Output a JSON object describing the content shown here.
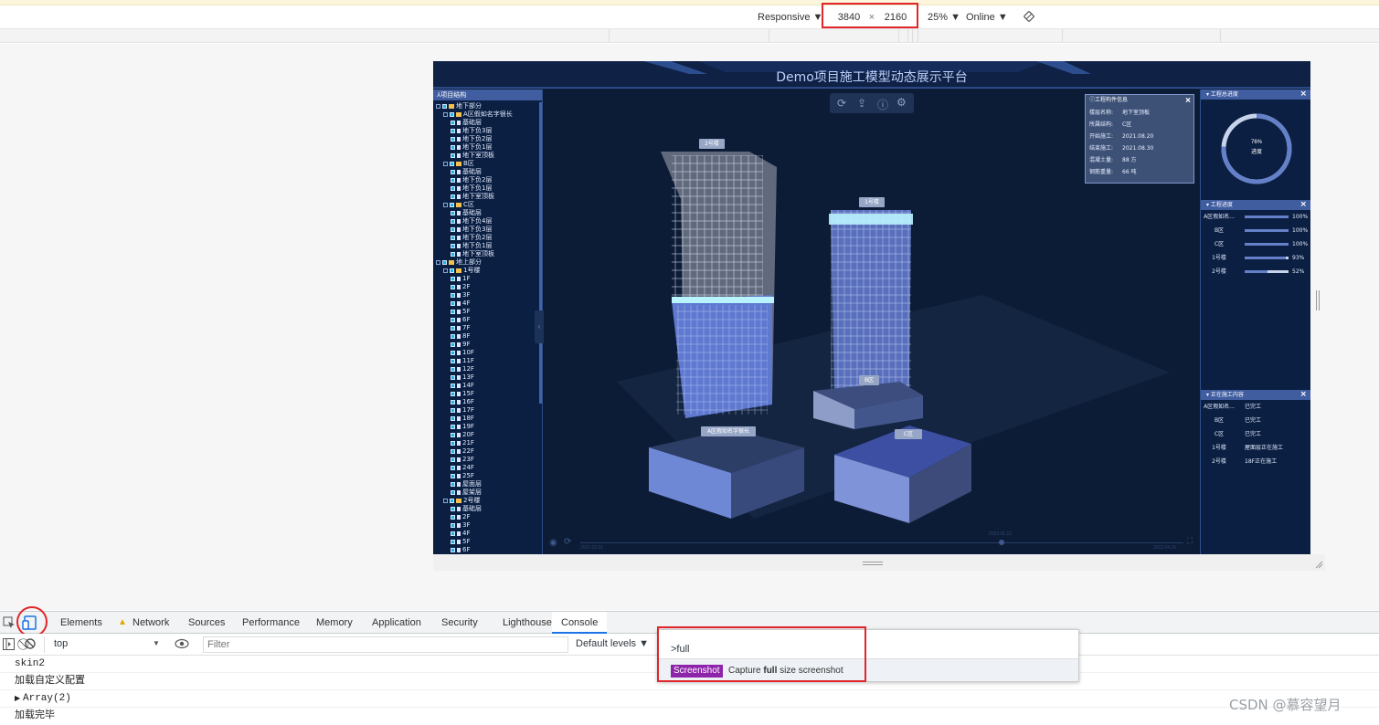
{
  "device_toolbar": {
    "device": "Responsive",
    "width": "3840",
    "times": "×",
    "height": "2160",
    "zoom": "25%",
    "network": "Online"
  },
  "app": {
    "title": "Demo项目施工模型动态展示平台",
    "tree_title": "项目结构",
    "tree": [
      {
        "depth": 0,
        "label": "地下部分",
        "type": "folder",
        "exp": true
      },
      {
        "depth": 1,
        "label": "A区假如名字很长",
        "type": "folder",
        "exp": true
      },
      {
        "depth": 2,
        "label": "基础层",
        "type": "file"
      },
      {
        "depth": 2,
        "label": "地下负3层",
        "type": "file"
      },
      {
        "depth": 2,
        "label": "地下负2层",
        "type": "file"
      },
      {
        "depth": 2,
        "label": "地下负1层",
        "type": "file"
      },
      {
        "depth": 2,
        "label": "地下室顶板",
        "type": "file"
      },
      {
        "depth": 1,
        "label": "B区",
        "type": "folder",
        "exp": true
      },
      {
        "depth": 2,
        "label": "基础层",
        "type": "file"
      },
      {
        "depth": 2,
        "label": "地下负2层",
        "type": "file"
      },
      {
        "depth": 2,
        "label": "地下负1层",
        "type": "file"
      },
      {
        "depth": 2,
        "label": "地下室顶板",
        "type": "file"
      },
      {
        "depth": 1,
        "label": "C区",
        "type": "folder",
        "exp": true
      },
      {
        "depth": 2,
        "label": "基础层",
        "type": "file"
      },
      {
        "depth": 2,
        "label": "地下负4层",
        "type": "file"
      },
      {
        "depth": 2,
        "label": "地下负3层",
        "type": "file"
      },
      {
        "depth": 2,
        "label": "地下负2层",
        "type": "file"
      },
      {
        "depth": 2,
        "label": "地下负1层",
        "type": "file"
      },
      {
        "depth": 2,
        "label": "地下室顶板",
        "type": "file"
      },
      {
        "depth": 0,
        "label": "地上部分",
        "type": "folder",
        "exp": true
      },
      {
        "depth": 1,
        "label": "1号楼",
        "type": "folder",
        "exp": true
      },
      {
        "depth": 2,
        "label": "1F",
        "type": "file"
      },
      {
        "depth": 2,
        "label": "2F",
        "type": "file"
      },
      {
        "depth": 2,
        "label": "3F",
        "type": "file"
      },
      {
        "depth": 2,
        "label": "4F",
        "type": "file"
      },
      {
        "depth": 2,
        "label": "5F",
        "type": "file"
      },
      {
        "depth": 2,
        "label": "6F",
        "type": "file"
      },
      {
        "depth": 2,
        "label": "7F",
        "type": "file"
      },
      {
        "depth": 2,
        "label": "8F",
        "type": "file"
      },
      {
        "depth": 2,
        "label": "9F",
        "type": "file"
      },
      {
        "depth": 2,
        "label": "10F",
        "type": "file"
      },
      {
        "depth": 2,
        "label": "11F",
        "type": "file"
      },
      {
        "depth": 2,
        "label": "12F",
        "type": "file"
      },
      {
        "depth": 2,
        "label": "13F",
        "type": "file"
      },
      {
        "depth": 2,
        "label": "14F",
        "type": "file"
      },
      {
        "depth": 2,
        "label": "15F",
        "type": "file"
      },
      {
        "depth": 2,
        "label": "16F",
        "type": "file"
      },
      {
        "depth": 2,
        "label": "17F",
        "type": "file"
      },
      {
        "depth": 2,
        "label": "18F",
        "type": "file"
      },
      {
        "depth": 2,
        "label": "19F",
        "type": "file"
      },
      {
        "depth": 2,
        "label": "20F",
        "type": "file"
      },
      {
        "depth": 2,
        "label": "21F",
        "type": "file"
      },
      {
        "depth": 2,
        "label": "22F",
        "type": "file"
      },
      {
        "depth": 2,
        "label": "23F",
        "type": "file"
      },
      {
        "depth": 2,
        "label": "24F",
        "type": "file"
      },
      {
        "depth": 2,
        "label": "25F",
        "type": "file"
      },
      {
        "depth": 2,
        "label": "屋面层",
        "type": "file"
      },
      {
        "depth": 2,
        "label": "屋架层",
        "type": "file"
      },
      {
        "depth": 1,
        "label": "2号楼",
        "type": "folder",
        "exp": true
      },
      {
        "depth": 2,
        "label": "基础层",
        "type": "file"
      },
      {
        "depth": 2,
        "label": "2F",
        "type": "file"
      },
      {
        "depth": 2,
        "label": "3F",
        "type": "file"
      },
      {
        "depth": 2,
        "label": "4F",
        "type": "file"
      },
      {
        "depth": 2,
        "label": "5F",
        "type": "file"
      },
      {
        "depth": 2,
        "label": "6F",
        "type": "file"
      }
    ],
    "scene_labels": [
      {
        "text": "2号楼"
      },
      {
        "text": "1号楼"
      },
      {
        "text": "B区"
      },
      {
        "text": "C区"
      },
      {
        "text": "A区假如名字很长"
      }
    ],
    "timeline": {
      "start": "2021.03.01",
      "mid": "2022.01.12",
      "end": "2022.04.15"
    },
    "info_panel": {
      "title": "工程构件信息",
      "rows": [
        {
          "k": "楼层名称:",
          "v": "地下室顶板"
        },
        {
          "k": "所属结构:",
          "v": "C区"
        },
        {
          "k": "开始施工:",
          "v": "2021.08.20"
        },
        {
          "k": "结束施工:",
          "v": "2021.08.30"
        },
        {
          "k": "混凝土量:",
          "v": "88 方"
        },
        {
          "k": "钢筋重量:",
          "v": "66 吨"
        }
      ]
    },
    "total_progress": {
      "title": "工程总进度",
      "percent": "76%",
      "label": "进度",
      "value": 0.76
    },
    "progress": {
      "title": "工程进度",
      "rows": [
        {
          "name": "A区假如名...",
          "pct": "100%",
          "value": 1.0
        },
        {
          "name": "B区",
          "pct": "100%",
          "value": 1.0
        },
        {
          "name": "C区",
          "pct": "100%",
          "value": 1.0
        },
        {
          "name": "1号楼",
          "pct": "93%",
          "value": 0.93
        },
        {
          "name": "2号楼",
          "pct": "52%",
          "value": 0.52
        }
      ]
    },
    "construction": {
      "title": "正在施工内容",
      "rows": [
        {
          "name": "A区假如名...",
          "status": "已完工"
        },
        {
          "name": "B区",
          "status": "已完工"
        },
        {
          "name": "C区",
          "status": "已完工"
        },
        {
          "name": "1号楼",
          "status": "屋面层正在施工"
        },
        {
          "name": "2号楼",
          "status": "18F正在施工"
        }
      ]
    }
  },
  "devtools": {
    "tabs": [
      "Elements",
      "Network",
      "Sources",
      "Performance",
      "Memory",
      "Application",
      "Security",
      "Lighthouse",
      "Console"
    ],
    "active_tab": "Console",
    "context": "top",
    "filter_placeholder": "Filter",
    "levels": "Default levels",
    "console_lines": [
      "skin2",
      "加载自定义配置",
      "Array(2)",
      "加载完毕"
    ],
    "command_input": ">full",
    "command_badge": "Screenshot",
    "command_desc_pre": "Capture ",
    "command_desc_bold": "full",
    "command_desc_post": " size screenshot"
  },
  "watermark": "CSDN @慕容望月"
}
